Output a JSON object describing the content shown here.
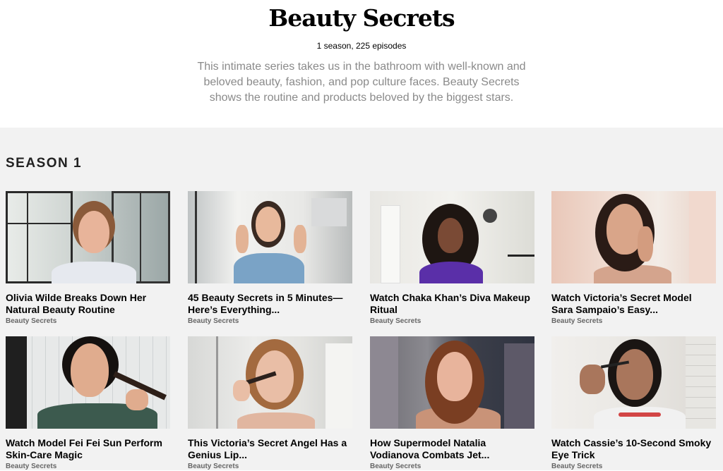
{
  "show": {
    "title": "Beauty Secrets",
    "meta": "1 season, 225 episodes",
    "description": "This intimate series takes us in the bathroom with well-known and beloved beauty, fashion, and pop culture faces. Beauty Secrets shows the routine and products beloved by the biggest stars."
  },
  "season": {
    "heading": "SEASON 1",
    "episodes": [
      {
        "title": "Olivia Wilde Breaks Down Her Natural Beauty Routine",
        "series": "Beauty Secrets"
      },
      {
        "title": "45 Beauty Secrets in 5 Minutes—Here’s Everything...",
        "series": "Beauty Secrets"
      },
      {
        "title": "Watch Chaka Khan’s Diva Makeup Ritual",
        "series": "Beauty Secrets"
      },
      {
        "title": "Watch Victoria’s Secret Model Sara Sampaio’s Easy...",
        "series": "Beauty Secrets"
      },
      {
        "title": "Watch Model Fei Fei Sun Perform Skin-Care Magic",
        "series": "Beauty Secrets"
      },
      {
        "title": "This Victoria’s Secret Angel Has a Genius Lip...",
        "series": "Beauty Secrets"
      },
      {
        "title": "How Supermodel Natalia Vodianova Combats Jet...",
        "series": "Beauty Secrets"
      },
      {
        "title": "Watch Cassie’s 10-Second Smoky Eye Trick",
        "series": "Beauty Secrets"
      }
    ]
  }
}
